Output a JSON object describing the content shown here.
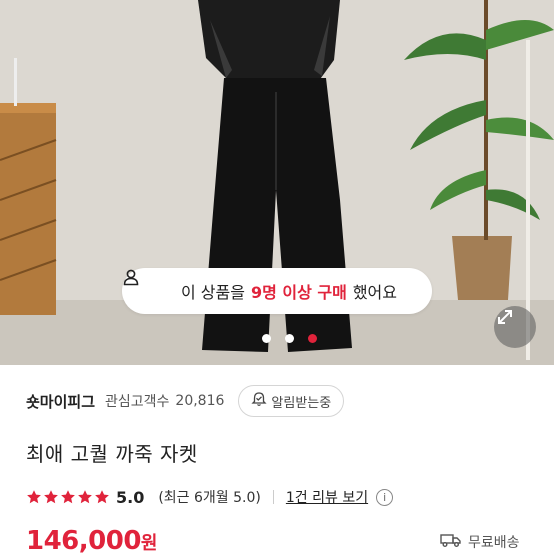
{
  "banner": {
    "pre": "이 상품을",
    "highlight": "9명 이상 구매",
    "post": "했어요"
  },
  "carousel": {
    "count": 3,
    "active_index": 2
  },
  "seller": {
    "name": "숏마이피그",
    "interest_label": "관심고객수",
    "interest_count": "20,816",
    "notify_label": "알림받는중"
  },
  "product": {
    "title": "최애 고퀄 까죽 자켓"
  },
  "rating": {
    "stars": 5,
    "score": "5.0",
    "recent": "(최근 6개월 5.0)",
    "review_link": "1건 리뷰 보기",
    "info_glyph": "i"
  },
  "price": {
    "amount": "146,000",
    "unit": "원"
  },
  "shipping": {
    "label": "무료배송"
  },
  "colors": {
    "accent": "#e0233b"
  },
  "icons": [
    "person-icon",
    "expand-icon",
    "bell-icon",
    "star-icon",
    "info-icon",
    "truck-icon"
  ]
}
